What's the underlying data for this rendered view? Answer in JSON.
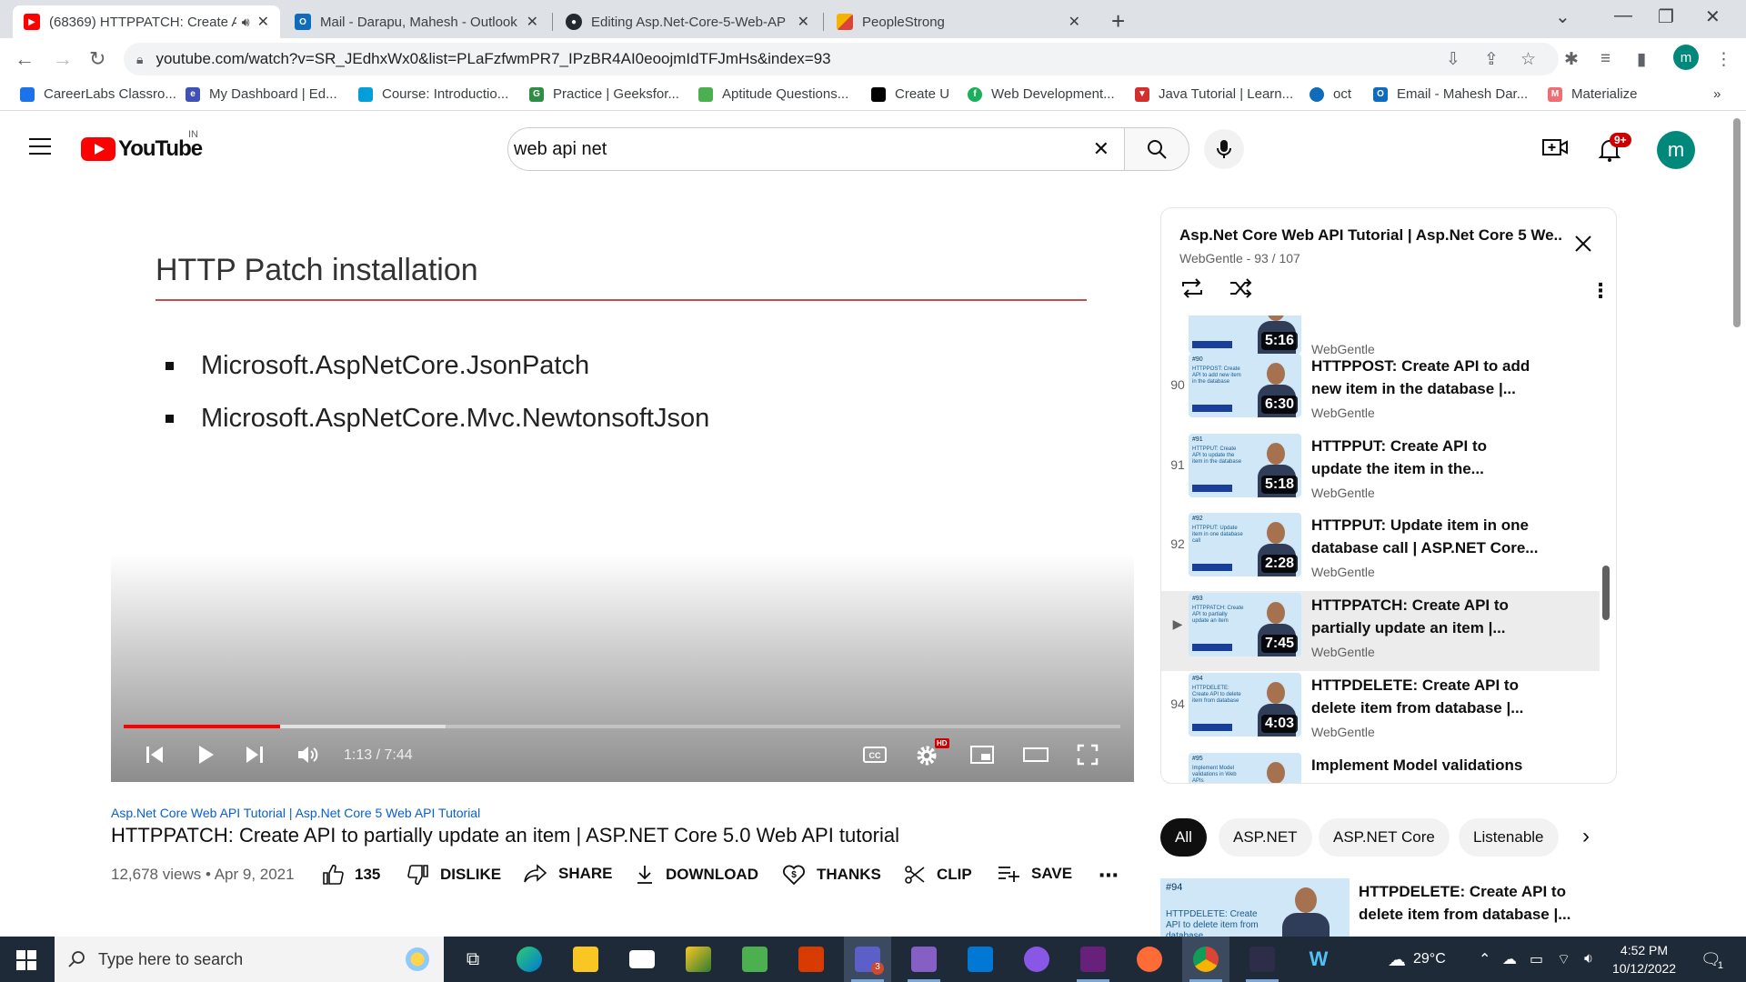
{
  "browser": {
    "tabs": [
      {
        "title": "(68369) HTTPPATCH: Create A",
        "favicon": "youtube",
        "color": "#ff0000",
        "active": true
      },
      {
        "title": "Mail - Darapu, Mahesh - Outlook",
        "favicon": "outlook",
        "color": "#0f6cbd",
        "active": false
      },
      {
        "title": "Editing Asp.Net-Core-5-Web-AP",
        "favicon": "github",
        "color": "#24292f",
        "active": false
      },
      {
        "title": "PeopleStrong",
        "favicon": "peoplestrong",
        "color": "#f4b400",
        "active": false
      }
    ],
    "url": "youtube.com/watch?v=SR_JEdhxWx0&list=PLaFzfwmPR7_IPzBR4AI0eoojmIdTFJmHs&index=93",
    "profile_letter": "m",
    "bookmarks": [
      {
        "label": "CareerLabs Classro...",
        "color": "#1a73e8"
      },
      {
        "label": "My Dashboard | Ed...",
        "color": "#3f51b5"
      },
      {
        "label": "Course: Introductio...",
        "color": "#049fd9"
      },
      {
        "label": "Practice | Geeksfor...",
        "color": "#2f8d46"
      },
      {
        "label": "Aptitude Questions...",
        "color": "#4caf50"
      },
      {
        "label": "Create U",
        "color": "#000000"
      },
      {
        "label": "Web Development...",
        "color": "#1aaf5d"
      },
      {
        "label": "Java Tutorial | Learn...",
        "color": "#d32f2f"
      },
      {
        "label": "oct",
        "color": "#0f6cbd"
      },
      {
        "label": "Email - Mahesh Dar...",
        "color": "#0f6cbd"
      },
      {
        "label": "Materialize",
        "color": "#ee6e73"
      }
    ]
  },
  "yt": {
    "logo_text": "YouTube",
    "country": "IN",
    "search_query": "web api net",
    "notif_count": "9+",
    "avatar_letter": "m"
  },
  "slide": {
    "title": "HTTP Patch installation",
    "bullets": [
      "Microsoft.AspNetCore.JsonPatch",
      "Microsoft.AspNetCore.Mvc.NewtonsoftJson"
    ]
  },
  "player": {
    "time": "1:13 / 7:44",
    "progress_fraction": 0.157,
    "hd_badge": "HD"
  },
  "video": {
    "playlist_link": "Asp.Net Core Web API Tutorial | Asp.Net Core 5 Web API Tutorial",
    "title": "HTTPPATCH: Create API to partially update an item | ASP.NET Core 5.0 Web API tutorial",
    "meta": "12,678 views • Apr 9, 2021",
    "actions": {
      "likes": "135",
      "dislike": "DISLIKE",
      "share": "SHARE",
      "download": "DOWNLOAD",
      "thanks": "THANKS",
      "clip": "CLIP",
      "save": "SAVE"
    }
  },
  "playlist": {
    "title": "Asp.Net Core Web API Tutorial | Asp.Net Core 5 We...",
    "sub": "WebGentle - 93 / 107",
    "items": [
      {
        "idx": "",
        "title": "",
        "channel": "WebGentle",
        "duration": "5:16",
        "thumb_num": "",
        "thumb_text": ""
      },
      {
        "idx": "90",
        "title": "HTTPPOST: Create API to add new item in the database |...",
        "channel": "WebGentle",
        "duration": "6:30",
        "thumb_num": "#90",
        "thumb_text": "HTTPPOST: Create API to add new item in the database"
      },
      {
        "idx": "91",
        "title": "HTTPPUT: Create API to update the item in the...",
        "channel": "WebGentle",
        "duration": "5:18",
        "thumb_num": "#91",
        "thumb_text": "HTTPPUT: Create API to update the item in the database"
      },
      {
        "idx": "92",
        "title": "HTTPPUT: Update item in one database call | ASP.NET Core...",
        "channel": "WebGentle",
        "duration": "2:28",
        "thumb_num": "#92",
        "thumb_text": "HTTPPUT: Update item in one database call"
      },
      {
        "idx": "▶",
        "title": "HTTPPATCH: Create API to partially update an item |...",
        "channel": "WebGentle",
        "duration": "7:45",
        "thumb_num": "#93",
        "thumb_text": "HTTPPATCH: Create API to partially update an item"
      },
      {
        "idx": "94",
        "title": "HTTPDELETE: Create API to delete item from database |...",
        "channel": "WebGentle",
        "duration": "4:03",
        "thumb_num": "#94",
        "thumb_text": "HTTPDELETE: Create API to delete item from database"
      },
      {
        "idx": "",
        "title": "Implement Model validations",
        "channel": "",
        "duration": "",
        "thumb_num": "#95",
        "thumb_text": "Implement Model validations in Web APIs"
      }
    ]
  },
  "chips": [
    "All",
    "ASP.NET",
    "ASP.NET Core",
    "Listenable"
  ],
  "recommendation": {
    "thumb_num": "#94",
    "thumb_text": "HTTPDELETE: Create API to delete item from database",
    "title": "HTTPDELETE: Create API to delete item from database |..."
  },
  "taskbar": {
    "search_placeholder": "Type here to search",
    "weather": "29°C",
    "time": "4:52 PM",
    "date": "10/12/2022",
    "notification_count": "1"
  }
}
